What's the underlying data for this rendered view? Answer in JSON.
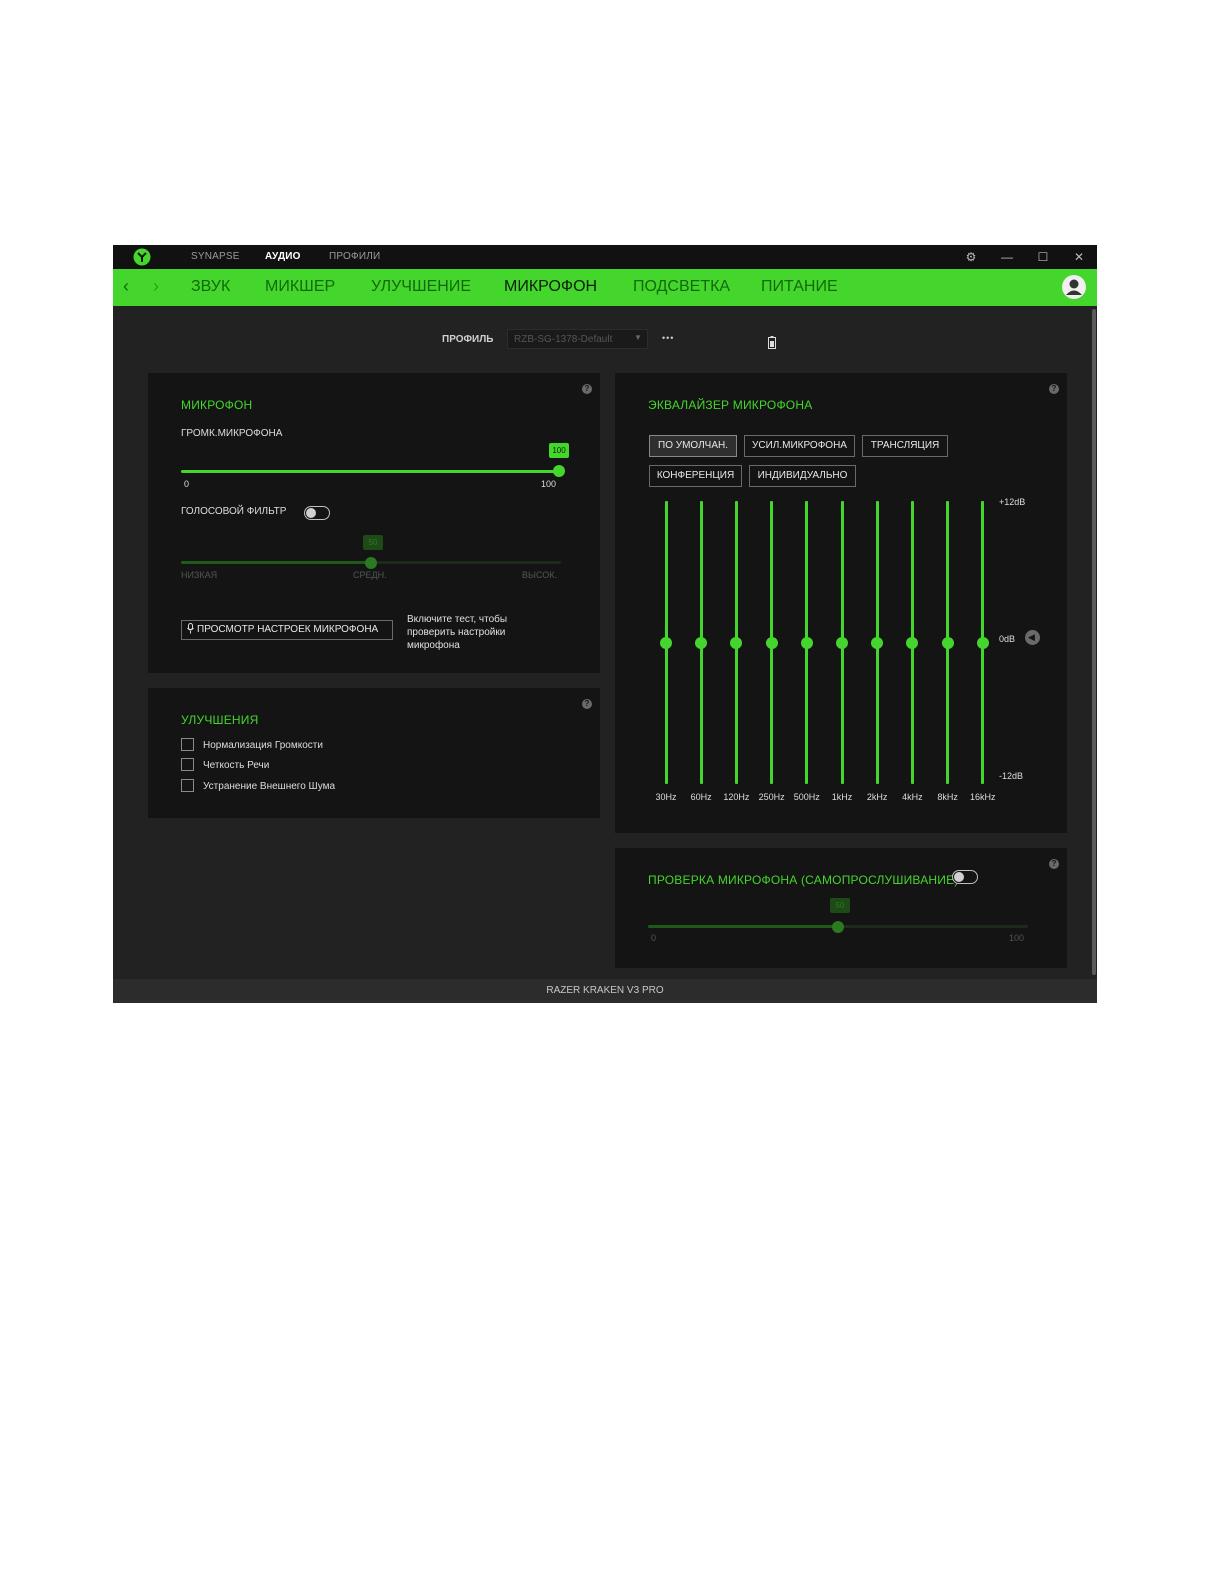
{
  "titlebar": {
    "tabs": [
      "SYNAPSE",
      "АУДИО",
      "ПРОФИЛИ"
    ],
    "active_tab": "АУДИО"
  },
  "nav": {
    "tabs": [
      "ЗВУК",
      "МИКШЕР",
      "УЛУЧШЕНИЕ",
      "МИКРОФОН",
      "ПОДСВЕТКА",
      "ПИТАНИЕ"
    ],
    "active_tab": "МИКРОФОН"
  },
  "profile": {
    "label": "ПРОФИЛЬ",
    "value": "RZB-SG-1378-Default",
    "more": "•••"
  },
  "microphone": {
    "title": "МИКРОФОН",
    "volume_label": "ГРОМК.МИКРОФОНА",
    "volume_value": 100,
    "volume_value_text": "100",
    "volume_min": "0",
    "volume_max": "100",
    "voice_filter_label": "ГОЛОСОВОЙ ФИЛЬТР",
    "voice_filter_on": false,
    "filter_value": 50,
    "filter_value_text": "50",
    "filter_low": "НИЗКАЯ",
    "filter_mid": "СРЕДН.",
    "filter_high": "ВЫСОК.",
    "test_button": "ПРОСМОТР НАСТРОЕК МИКРОФОНА",
    "test_hint": "Включите тест, чтобы проверить настройки микрофона"
  },
  "enhancements": {
    "title": "УЛУЧШЕНИЯ",
    "items": [
      {
        "label": "Нормализация Громкости",
        "checked": false
      },
      {
        "label": "Четкость Речи",
        "checked": false
      },
      {
        "label": "Устранение Внешнего Шума",
        "checked": false
      }
    ]
  },
  "equalizer": {
    "title": "ЭКВАЛАЙЗЕР МИКРОФОНА",
    "presets": [
      "ПО УМОЛЧАН.",
      "УСИЛ.МИКРОФОНА",
      "ТРАНСЛЯЦИЯ",
      "КОНФЕРЕНЦИЯ",
      "ИНДИВИДУАЛЬНО"
    ],
    "active_preset": "ПО УМОЛЧАН.",
    "scale_top": "+12dB",
    "scale_mid": "0dB",
    "scale_bottom": "-12dB",
    "bands": [
      "30Hz",
      "60Hz",
      "120Hz",
      "250Hz",
      "500Hz",
      "1kHz",
      "2kHz",
      "4kHz",
      "8kHz",
      "16kHz"
    ],
    "gains_db": [
      0,
      0,
      0,
      0,
      0,
      0,
      0,
      0,
      0,
      0
    ]
  },
  "sidetone": {
    "title": "ПРОВЕРКА МИКРОФОНА (САМОПРОСЛУШИВАНИЕ)",
    "enabled": false,
    "value": 50,
    "value_text": "50",
    "min": "0",
    "max": "100"
  },
  "footer": {
    "device": "RAZER KRAKEN V3 PRO"
  },
  "colors": {
    "accent": "#44d62c",
    "background": "#222222",
    "panel": "#141414"
  }
}
